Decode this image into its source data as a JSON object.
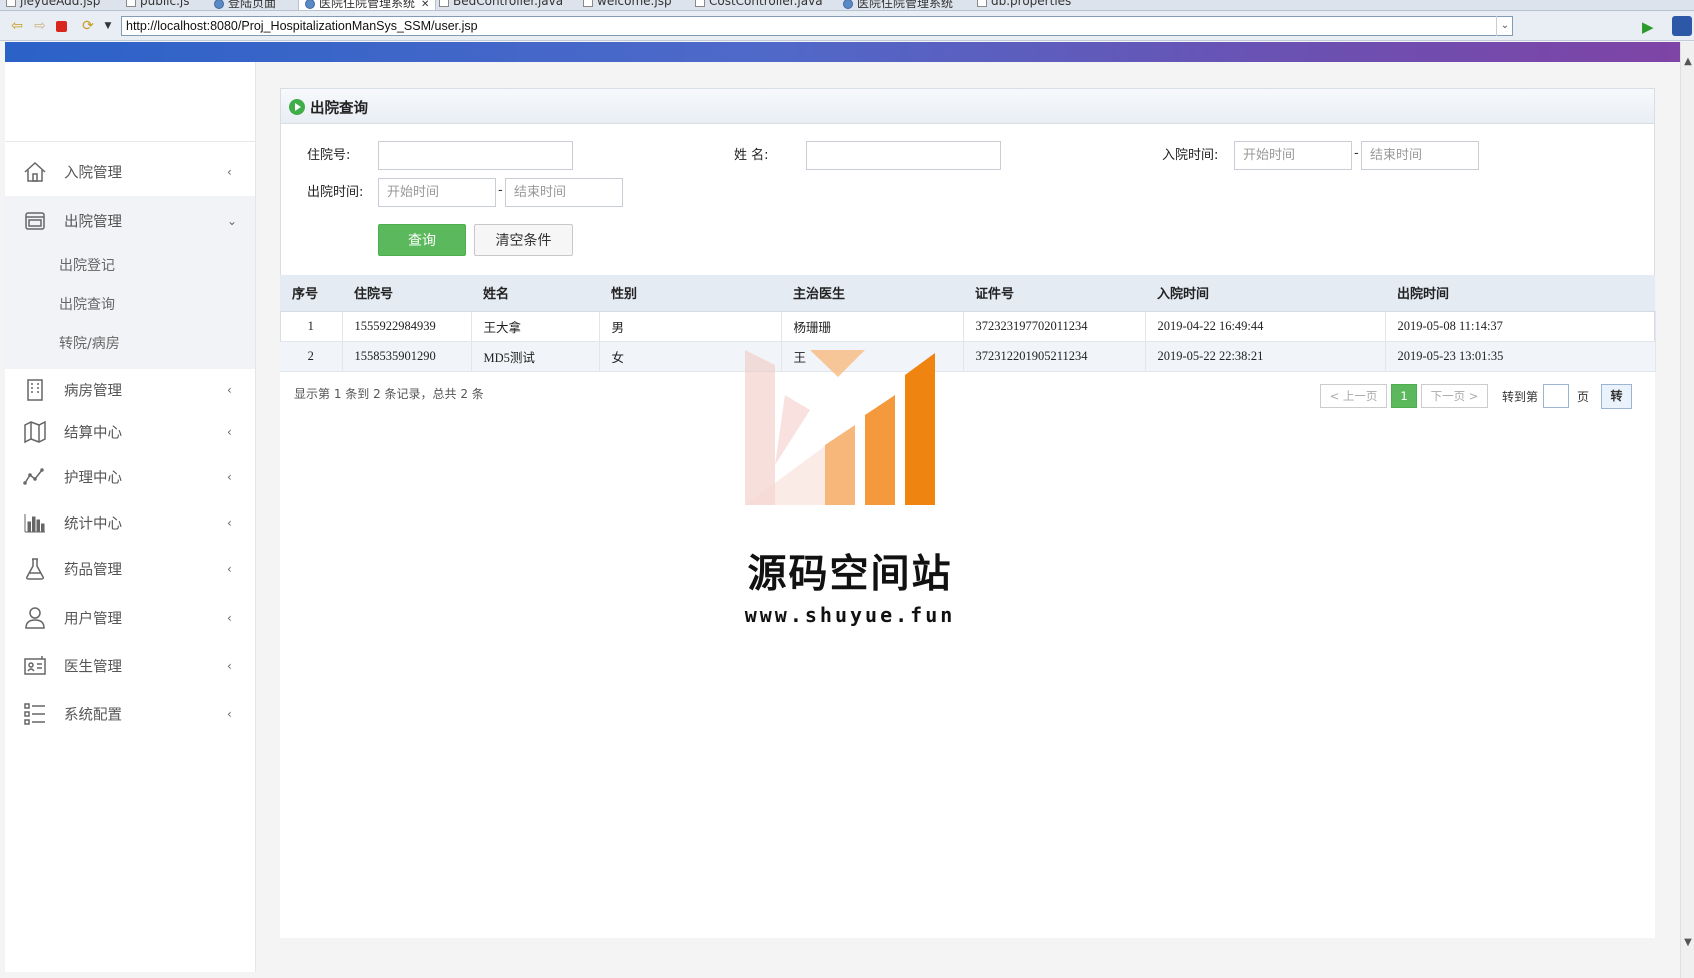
{
  "browser": {
    "tabs": [
      {
        "label": "jieyueAdd.jsp",
        "icon": "file-icon"
      },
      {
        "label": "public.js",
        "icon": "file-icon"
      },
      {
        "label": "登陆页面",
        "icon": "globe-icon"
      },
      {
        "label": "医院住院管理系统",
        "icon": "globe-icon",
        "active": true
      },
      {
        "label": "BedController.java",
        "icon": "file-icon"
      },
      {
        "label": "welcome.jsp",
        "icon": "file-icon"
      },
      {
        "label": "CostController.java",
        "icon": "file-icon"
      },
      {
        "label": "医院住院管理系统",
        "icon": "globe-icon"
      },
      {
        "label": "db.properties",
        "icon": "file-icon"
      }
    ],
    "url": "http://localhost:8080/Proj_HospitalizationManSys_SSM/user.jsp"
  },
  "sidebar": {
    "items": [
      {
        "label": "入院管理",
        "icon": "home-icon"
      },
      {
        "label": "出院管理",
        "icon": "window-icon",
        "open": true
      },
      {
        "label": "病房管理",
        "icon": "building-icon"
      },
      {
        "label": "结算中心",
        "icon": "map-icon"
      },
      {
        "label": "护理中心",
        "icon": "line-chart-icon"
      },
      {
        "label": "统计中心",
        "icon": "bar-chart-icon"
      },
      {
        "label": "药品管理",
        "icon": "flask-icon"
      },
      {
        "label": "用户管理",
        "icon": "user-icon"
      },
      {
        "label": "医生管理",
        "icon": "id-card-icon"
      },
      {
        "label": "系统配置",
        "icon": "list-icon"
      }
    ],
    "submenu": [
      "出院登记",
      "出院查询",
      "转院/病房"
    ]
  },
  "panel": {
    "title": "出院查询",
    "form": {
      "hospital_no_label": "住院号:",
      "name_label": "姓 名:",
      "admit_time_label": "入院时间:",
      "discharge_time_label": "出院时间:",
      "start_placeholder": "开始时间",
      "end_placeholder": "结束时间",
      "dash": "-",
      "query_button": "查询",
      "clear_button": "清空条件"
    }
  },
  "table": {
    "columns": [
      "序号",
      "住院号",
      "姓名",
      "性别",
      "主治医生",
      "证件号",
      "入院时间",
      "出院时间"
    ],
    "rows": [
      [
        "1",
        "1555922984939",
        "王大拿",
        "男",
        "杨珊珊",
        "372323197702011234",
        "2019-04-22 16:49:44",
        "2019-05-08 11:14:37"
      ],
      [
        "2",
        "1558535901290",
        "MD5测试",
        "女",
        "王",
        "372312201905211234",
        "2019-05-22 22:38:21",
        "2019-05-23 13:01:35"
      ]
    ]
  },
  "pagination": {
    "info": "显示第 1 条到 2 条记录，总共 2 条",
    "prev": "< 上一页",
    "current": "1",
    "next": "下一页 >",
    "goto_label": "转到第",
    "page_unit": "页",
    "goto_button": "转"
  },
  "watermark": {
    "text": "源码空间站",
    "url": "www.shuyue.fun"
  }
}
